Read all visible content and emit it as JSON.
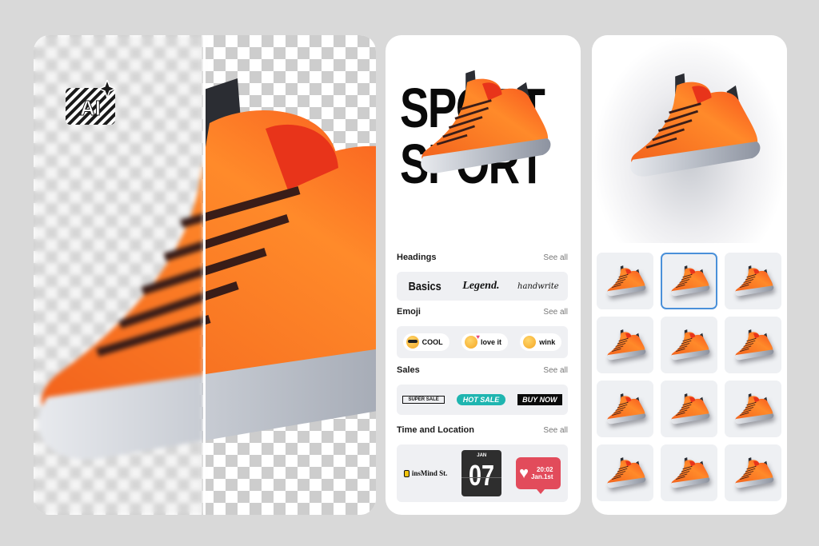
{
  "panel_remove_bg": {
    "badge_label": "AI",
    "badge_icon": "ai-sparkle-icon"
  },
  "panel_templates": {
    "hero_text_top": "SPORT",
    "hero_text_bottom": "SPORT",
    "sections": [
      {
        "title": "Headings",
        "see_all": "See all",
        "items": [
          "Basics",
          "Legend.",
          "handwrite"
        ]
      },
      {
        "title": "Emoji",
        "see_all": "See all",
        "items": [
          {
            "icon": "cool-emoji-icon",
            "label": "COOL"
          },
          {
            "icon": "love-emoji-icon",
            "label": "love it"
          },
          {
            "icon": "wink-emoji-icon",
            "label": "wink"
          }
        ]
      },
      {
        "title": "Sales",
        "see_all": "See all",
        "items": [
          "SUPER SALE",
          "HOT SALE",
          "BUY NOW"
        ]
      },
      {
        "title": "Time and Location",
        "see_all": "See all",
        "location": "insMind St.",
        "calendar_month": "JAN",
        "calendar_day": "07",
        "bubble_time": "20:02",
        "bubble_date": "Jan.1st"
      }
    ]
  },
  "panel_shadows": {
    "selected_index": 1,
    "thumb_count": 12,
    "accent": "#4a90d9"
  }
}
